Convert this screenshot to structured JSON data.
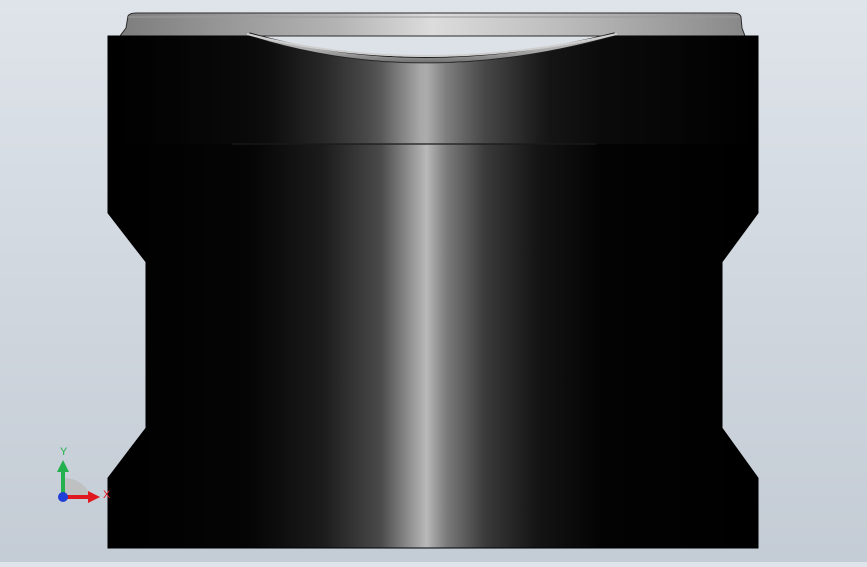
{
  "viewport": {
    "background_top": "#dfe4ea",
    "background_bottom": "#c4ccd5"
  },
  "model": {
    "body_color": "#000000",
    "highlight_color": "#b9b9b9",
    "cap_color": "#d6d6d6"
  },
  "triad": {
    "x_label": "X",
    "y_label": "Y",
    "x_color": "#e0171e",
    "y_color": "#22b14c",
    "z_color": "#1f3fd6"
  }
}
